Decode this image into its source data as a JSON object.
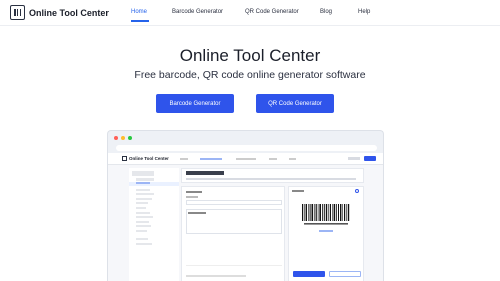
{
  "brand": {
    "name": "Online Tool Center",
    "accent": "#2f54eb"
  },
  "nav": {
    "items": [
      {
        "label": "Home",
        "active": true
      },
      {
        "label": "Barcode Generator",
        "active": false
      },
      {
        "label": "QR Code Generator",
        "active": false
      },
      {
        "label": "Blog",
        "active": false
      },
      {
        "label": "Help",
        "active": false
      }
    ]
  },
  "hero": {
    "title": "Online Tool Center",
    "subtitle": "Free barcode, QR code online generator software",
    "buttons": {
      "barcode": "Barcode Generator",
      "qrcode": "QR Code Generator"
    }
  }
}
